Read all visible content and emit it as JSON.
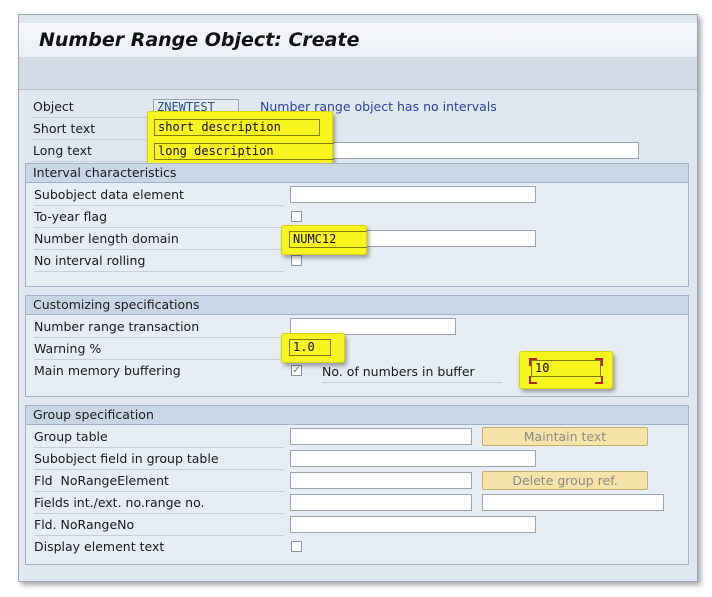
{
  "title": "Number Range Object: Create",
  "object": {
    "label": "Object",
    "value": "ZNEWTEST",
    "info": "Number range object has no intervals"
  },
  "short_text": {
    "label": "Short text",
    "value": "short description"
  },
  "long_text": {
    "label": "Long text",
    "value": "long description"
  },
  "interval": {
    "heading": "Interval characteristics",
    "subobject_label": "Subobject data element",
    "to_year_label": "To-year flag",
    "length_domain_label": "Number length domain",
    "length_domain_value": "NUMC12",
    "no_rolling_label": "No interval rolling"
  },
  "customizing": {
    "heading": "Customizing specifications",
    "transaction_label": "Number range transaction",
    "warning_label": "Warning %",
    "warning_value": "1.0",
    "buffering_label": "Main memory buffering",
    "buffering_checked": true,
    "buffer_count_label": "No. of numbers in buffer",
    "buffer_count_value": "10"
  },
  "group": {
    "heading": "Group specification",
    "table_label": "Group table",
    "maintain_button": "Maintain text",
    "subobject_field_label": "Subobject field in group table",
    "fld_element_label": "Fld  NoRangeElement",
    "delete_button": "Delete group ref.",
    "fields_label": "Fields int./ext. no.range no.",
    "fld_no_label": "Fld. NoRangeNo",
    "display_label": "Display element text"
  },
  "colors": {
    "highlight": "#f7f51d",
    "accent": "#2a3fa0"
  }
}
